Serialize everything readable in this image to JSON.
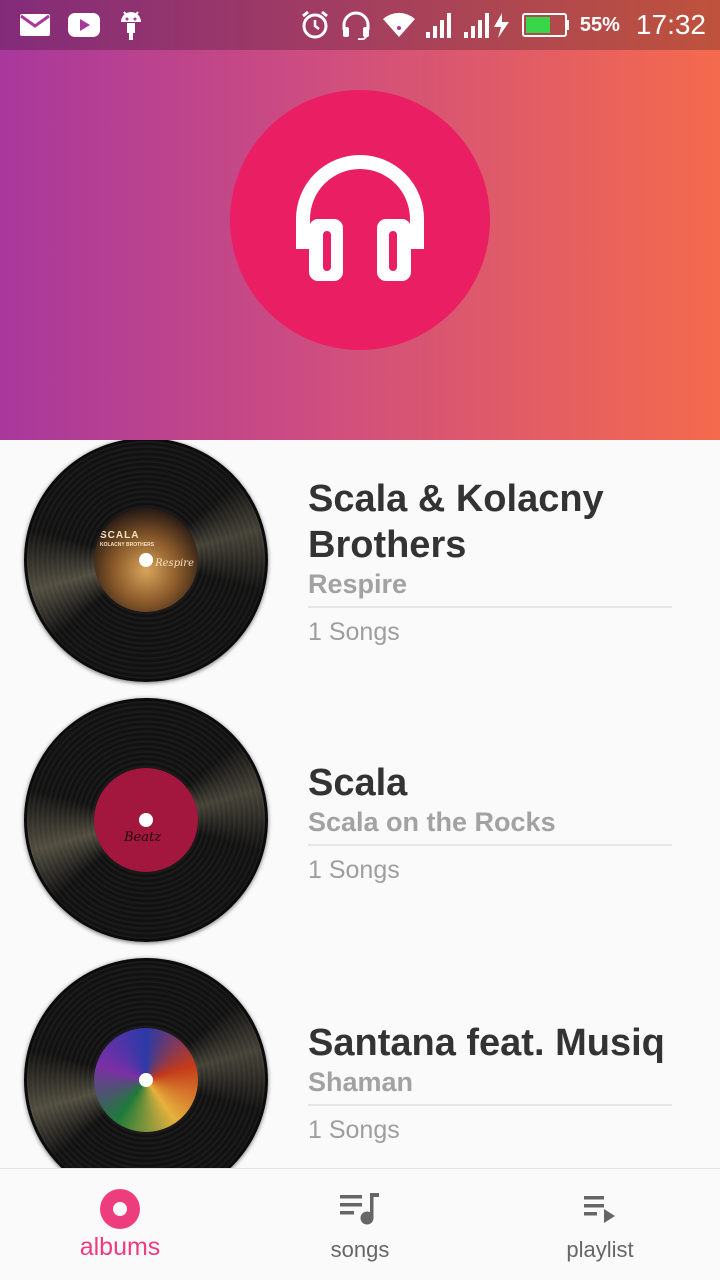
{
  "status_bar": {
    "icons_left": [
      "mail-icon",
      "youtube-icon",
      "android-icon"
    ],
    "icons_right": [
      "alarm-icon",
      "headset-icon",
      "wifi-icon",
      "signal-icon",
      "signal-charging-icon",
      "battery-icon"
    ],
    "battery_percent": "55%",
    "time": "17:32"
  },
  "header": {
    "logo_icon": "headphones-icon",
    "colors": {
      "gradient_start": "#a8389c",
      "gradient_end": "#f46a4d",
      "logo_circle": "#e91e63"
    }
  },
  "albums": [
    {
      "artist": "Scala & Kolacny Brothers",
      "album": "Respire",
      "count": "1 Songs",
      "label_text": [
        "SCALA",
        "KOLACNY BROTHERS",
        "Respire"
      ]
    },
    {
      "artist": "Scala",
      "album": "Scala on the Rocks",
      "count": "1 Songs",
      "label_text": [
        "Beatz"
      ]
    },
    {
      "artist": "Santana feat. Musiq",
      "album": "Shaman",
      "count": "1 Songs"
    }
  ],
  "bottom_nav": {
    "items": [
      {
        "label": "albums",
        "icon": "disc-icon",
        "active": true
      },
      {
        "label": "songs",
        "icon": "music-list-icon",
        "active": false
      },
      {
        "label": "playlist",
        "icon": "playlist-play-icon",
        "active": false
      }
    ],
    "active_color": "#ee3d7d"
  }
}
